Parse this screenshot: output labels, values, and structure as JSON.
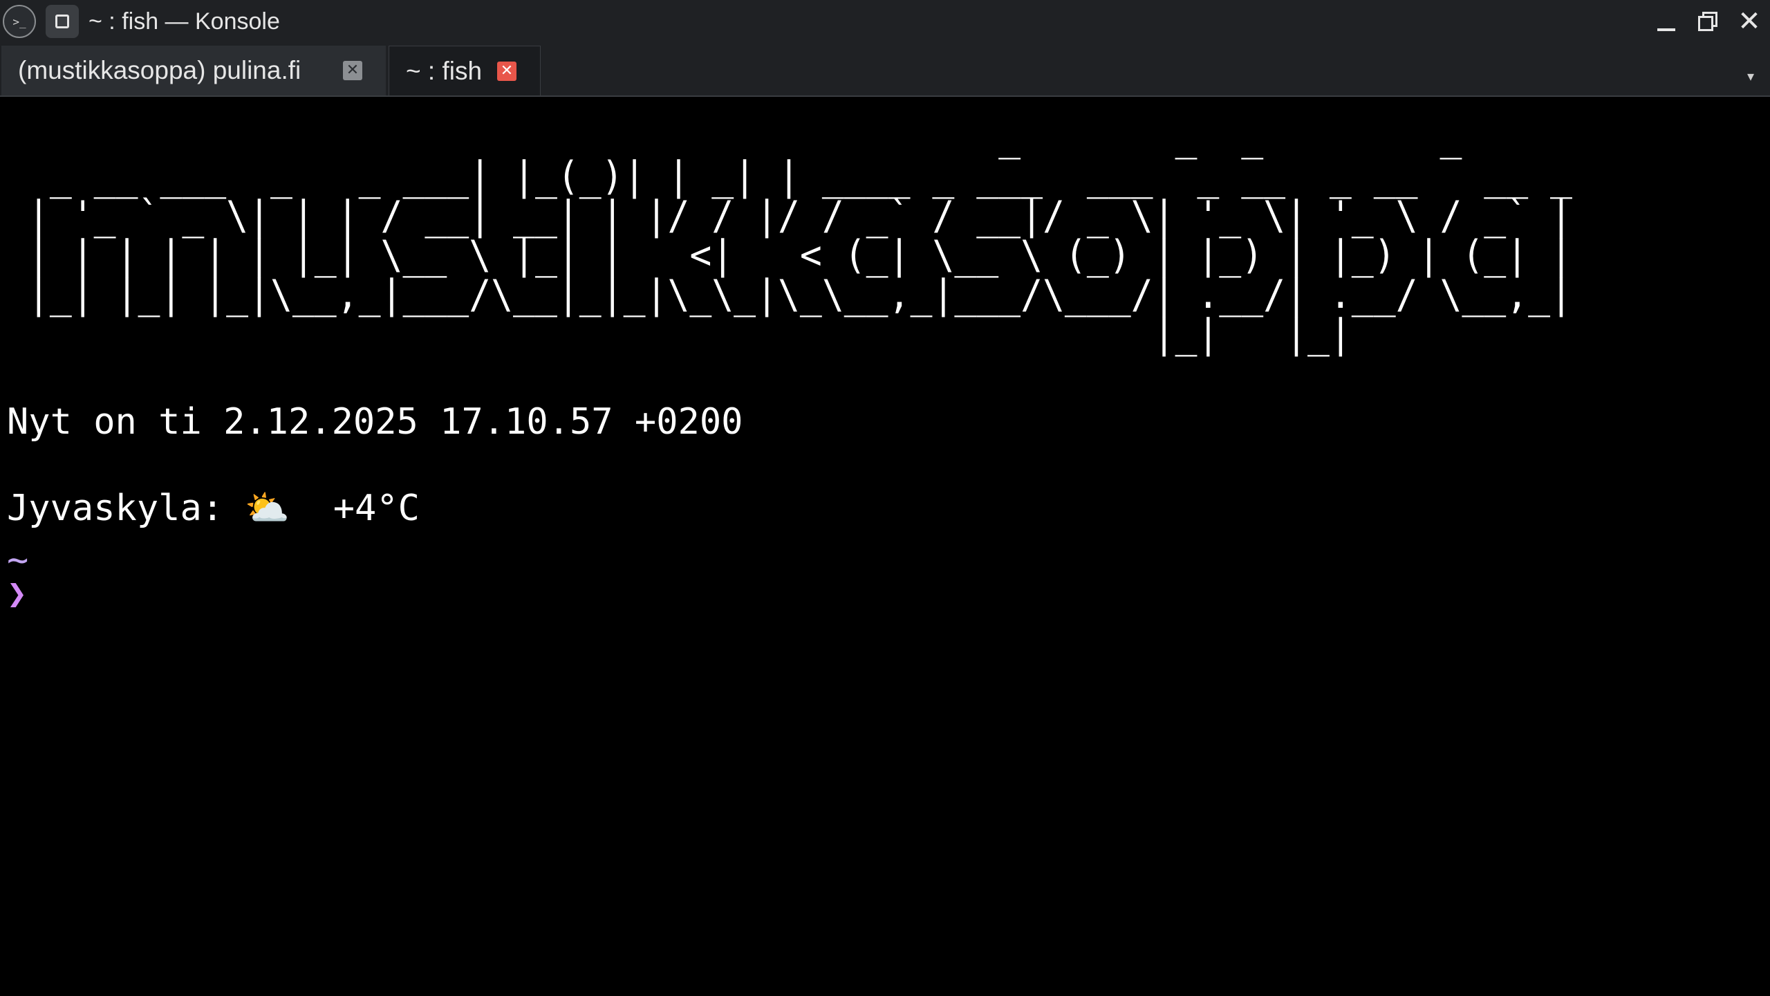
{
  "window": {
    "title": "~ : fish — Konsole",
    "icons": {
      "app": "konsole-terminal-icon",
      "pin": "keep-above-icon",
      "minimize": "minimize-icon",
      "maximize": "restore-icon",
      "close": "close-icon"
    },
    "app_icon_glyph": ">_",
    "close_glyph": "✕"
  },
  "tabs": [
    {
      "label": "(mustikkasoppa) pulina.fi",
      "active": false,
      "close_glyph": "✕"
    },
    {
      "label": "~ : fish",
      "active": true,
      "close_glyph": "✕"
    }
  ],
  "tab_menu_glyph": "▾",
  "terminal": {
    "banner": "                                             _       _  _        _\n  _ __ ___  _   _ ___| |_(_)| | _| | ____ _ ___  ___  _ __  _ __   __ _\n | '_ ` _ \\| | | / __| __| | |/ / |/ / _` / __|/ _ \\| '_ \\| '_ \\ / _` |\n | | | | | | |_| \\__ \\ |_| |   <|   < (_| \\__ \\ (_) | |_) | |_) | (_| |\n |_| |_| |_|\\__,_|___/\\__|_|_|\\_\\_|\\_\\__,_|___/\\___/| .__/| .__/ \\__,_|\n                                                    |_|   |_|",
    "date_line": "Nyt on ti 2.12.2025 17.10.57 +0200",
    "weather_line": "Jyvaskyla: ⛅  +4°C",
    "cwd": "~",
    "prompt": "❯"
  },
  "colors": {
    "chrome_bg": "#1f2124",
    "terminal_bg": "#000000",
    "terminal_fg": "#ffffff",
    "cwd": "#c3a6f2",
    "prompt": "#d48af7",
    "active_tab_close": "#e8564a"
  }
}
